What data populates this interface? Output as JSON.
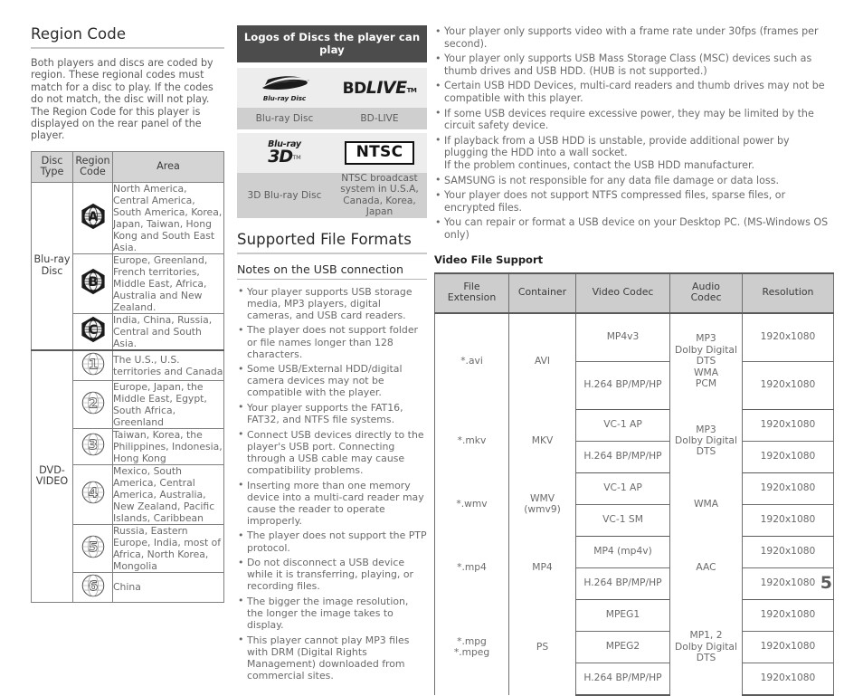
{
  "page": {
    "number": "5"
  },
  "region_section": {
    "title": "Region Code",
    "intro": "Both players and discs are coded by region. These regional codes must match for a disc to play. If the codes do not match, the disc will not play.\nThe Region Code for this player is displayed on the rear panel of the player.",
    "table": {
      "headers": [
        "Disc Type",
        "Region Code",
        "Area"
      ],
      "header_disc_type_line1": "Disc",
      "header_disc_type_line2": "Type",
      "header_region_line1": "Region",
      "header_region_line2": "Code",
      "header_area": "Area",
      "groups": [
        {
          "disc_type": "Blu-ray Disc",
          "disc_type_line1": "Blu-ray",
          "disc_type_line2": "Disc",
          "rows": [
            {
              "code": "A",
              "icon": "bluray-region-a-icon",
              "area": "North America, Central America, South America, Korea, Japan, Taiwan, Hong Kong and South East Asia."
            },
            {
              "code": "B",
              "icon": "bluray-region-b-icon",
              "area": "Europe, Greenland, French territories, Middle East, Africa, Australia and New Zealand."
            },
            {
              "code": "C",
              "icon": "bluray-region-c-icon",
              "area": "India, China, Russia, Central and South Asia."
            }
          ]
        },
        {
          "disc_type": "DVD-VIDEO",
          "disc_type_line1": "DVD-",
          "disc_type_line2": "VIDEO",
          "rows": [
            {
              "code": "1",
              "icon": "dvd-region-1-icon",
              "area": "The U.S., U.S. territories and Canada"
            },
            {
              "code": "2",
              "icon": "dvd-region-2-icon",
              "area": "Europe, Japan, the Middle East, Egypt, South Africa, Greenland"
            },
            {
              "code": "3",
              "icon": "dvd-region-3-icon",
              "area": "Taiwan, Korea, the Philippines, Indonesia, Hong Kong"
            },
            {
              "code": "4",
              "icon": "dvd-region-4-icon",
              "area": "Mexico, South America, Central America, Australia, New Zealand, Pacific Islands, Caribbean"
            },
            {
              "code": "5",
              "icon": "dvd-region-5-icon",
              "area": "Russia, Eastern Europe, India, most of Africa, North Korea, Mongolia"
            },
            {
              "code": "6",
              "icon": "dvd-region-6-icon",
              "area": "China"
            }
          ]
        }
      ]
    }
  },
  "logos_section": {
    "header": "Logos of Discs the player can play",
    "items": [
      {
        "logo": "bluray-disc-logo",
        "logo_text": "Blu-ray Disc",
        "caption": "Blu-ray Disc"
      },
      {
        "logo": "bd-live-logo",
        "logo_text_bd": "BD",
        "logo_text_live": "LIVE",
        "logo_tm": "TM",
        "caption": "BD-LIVE"
      },
      {
        "logo": "bluray-3d-logo",
        "logo_text_br": "Blu-ray",
        "logo_text_3d": "3D",
        "logo_tm": "TM",
        "caption": "3D Blu-ray Disc"
      },
      {
        "logo": "ntsc-logo",
        "logo_text": "NTSC",
        "caption": "NTSC broadcast system in U.S.A, Canada, Korea, Japan"
      }
    ]
  },
  "formats_section": {
    "title": "Supported File Formats",
    "usb_notes_title": "Notes on the USB connection",
    "usb_notes": [
      "Your player supports USB storage media, MP3 players, digital cameras, and USB card readers.",
      "The player does not support folder or file names longer than 128 characters.",
      "Some USB/External HDD/digital camera devices may not be compatible with the player.",
      "Your player supports the FAT16, FAT32, and NTFS file systems.",
      "Connect USB devices directly to the player's USB port. Connecting through a USB cable may cause compatibility problems.",
      "Inserting more than one memory device into a multi-card reader may cause the reader to operate improperly.",
      "The player does not support the PTP protocol.",
      "Do not disconnect a USB device while it is transferring, playing, or recording files.",
      "The bigger the image resolution, the longer the image takes to display.",
      "This player cannot play MP3 files with DRM (Digital Rights Management) downloaded from commercial sites."
    ]
  },
  "right_notes": [
    "Your player only supports video with a frame rate under 30fps (frames per second).",
    "Your player only supports USB Mass Storage Class (MSC) devices such as thumb drives and USB HDD. (HUB is not supported.)",
    "Certain USB HDD Devices, multi-card readers and thumb drives may not be compatible with this player.",
    "If some USB devices require excessive power, they may be limited by the circuit safety device.",
    "If playback from a USB HDD is unstable, provide additional power by plugging the HDD into a wall socket.\nIf the problem continues, contact the USB HDD manufacturer.",
    "SAMSUNG is not responsible for any data file damage or data loss.",
    "Your player does not support NTFS compressed files, sparse files, or encrypted files.",
    "You can repair or format a USB device on your Desktop PC. (MS-Windows OS only)"
  ],
  "video_support": {
    "title": "Video File Support",
    "headers": {
      "file_extension_l1": "File",
      "file_extension_l2": "Extension",
      "container": "Container",
      "video_codec": "Video Codec",
      "audio_codec_l1": "Audio",
      "audio_codec_l2": "Codec",
      "resolution": "Resolution"
    },
    "groups": [
      {
        "extension": "*.avi",
        "container": "AVI",
        "audio_codec": "MP3\nDolby Digital\nDTS\nWMA\nPCM",
        "rows": [
          {
            "video_codec": "MP4v3",
            "resolution": "1920x1080"
          },
          {
            "video_codec": "H.264 BP/MP/HP",
            "resolution": "1920x1080"
          }
        ]
      },
      {
        "extension": "*.mkv",
        "container": "MKV",
        "audio_codec": "MP3\nDolby Digital\nDTS",
        "rows": [
          {
            "video_codec": "VC-1 AP",
            "resolution": "1920x1080"
          },
          {
            "video_codec": "H.264 BP/MP/HP",
            "resolution": "1920x1080"
          }
        ]
      },
      {
        "extension": "*.wmv",
        "container": "WMV (wmv9)",
        "audio_codec": "WMA",
        "rows": [
          {
            "video_codec": "VC-1 AP",
            "resolution": "1920x1080"
          },
          {
            "video_codec": "VC-1 SM",
            "resolution": "1920x1080"
          }
        ]
      },
      {
        "extension": "*.mp4",
        "container": "MP4",
        "audio_codec": "AAC",
        "rows": [
          {
            "video_codec": "MP4 (mp4v)",
            "resolution": "1920x1080"
          },
          {
            "video_codec": "H.264 BP/MP/HP",
            "resolution": "1920x1080"
          }
        ]
      },
      {
        "extension": "*.mpg\n*.mpeg",
        "container": "PS",
        "audio_codec": "MP1, 2\nDolby Digital\nDTS",
        "rows": [
          {
            "video_codec": "MPEG1",
            "resolution": "1920x1080"
          },
          {
            "video_codec": "MPEG2",
            "resolution": "1920x1080"
          },
          {
            "video_codec": "H.264 BP/MP/HP",
            "resolution": "1920x1080"
          }
        ]
      }
    ]
  },
  "colors": {
    "header_band": "#4c4c4c",
    "table_header_bg": "#d4d4d4",
    "logo_art_bg": "#ededed",
    "logo_caption_bg": "#cfcfcf",
    "body_text": "#6a6a6a"
  }
}
